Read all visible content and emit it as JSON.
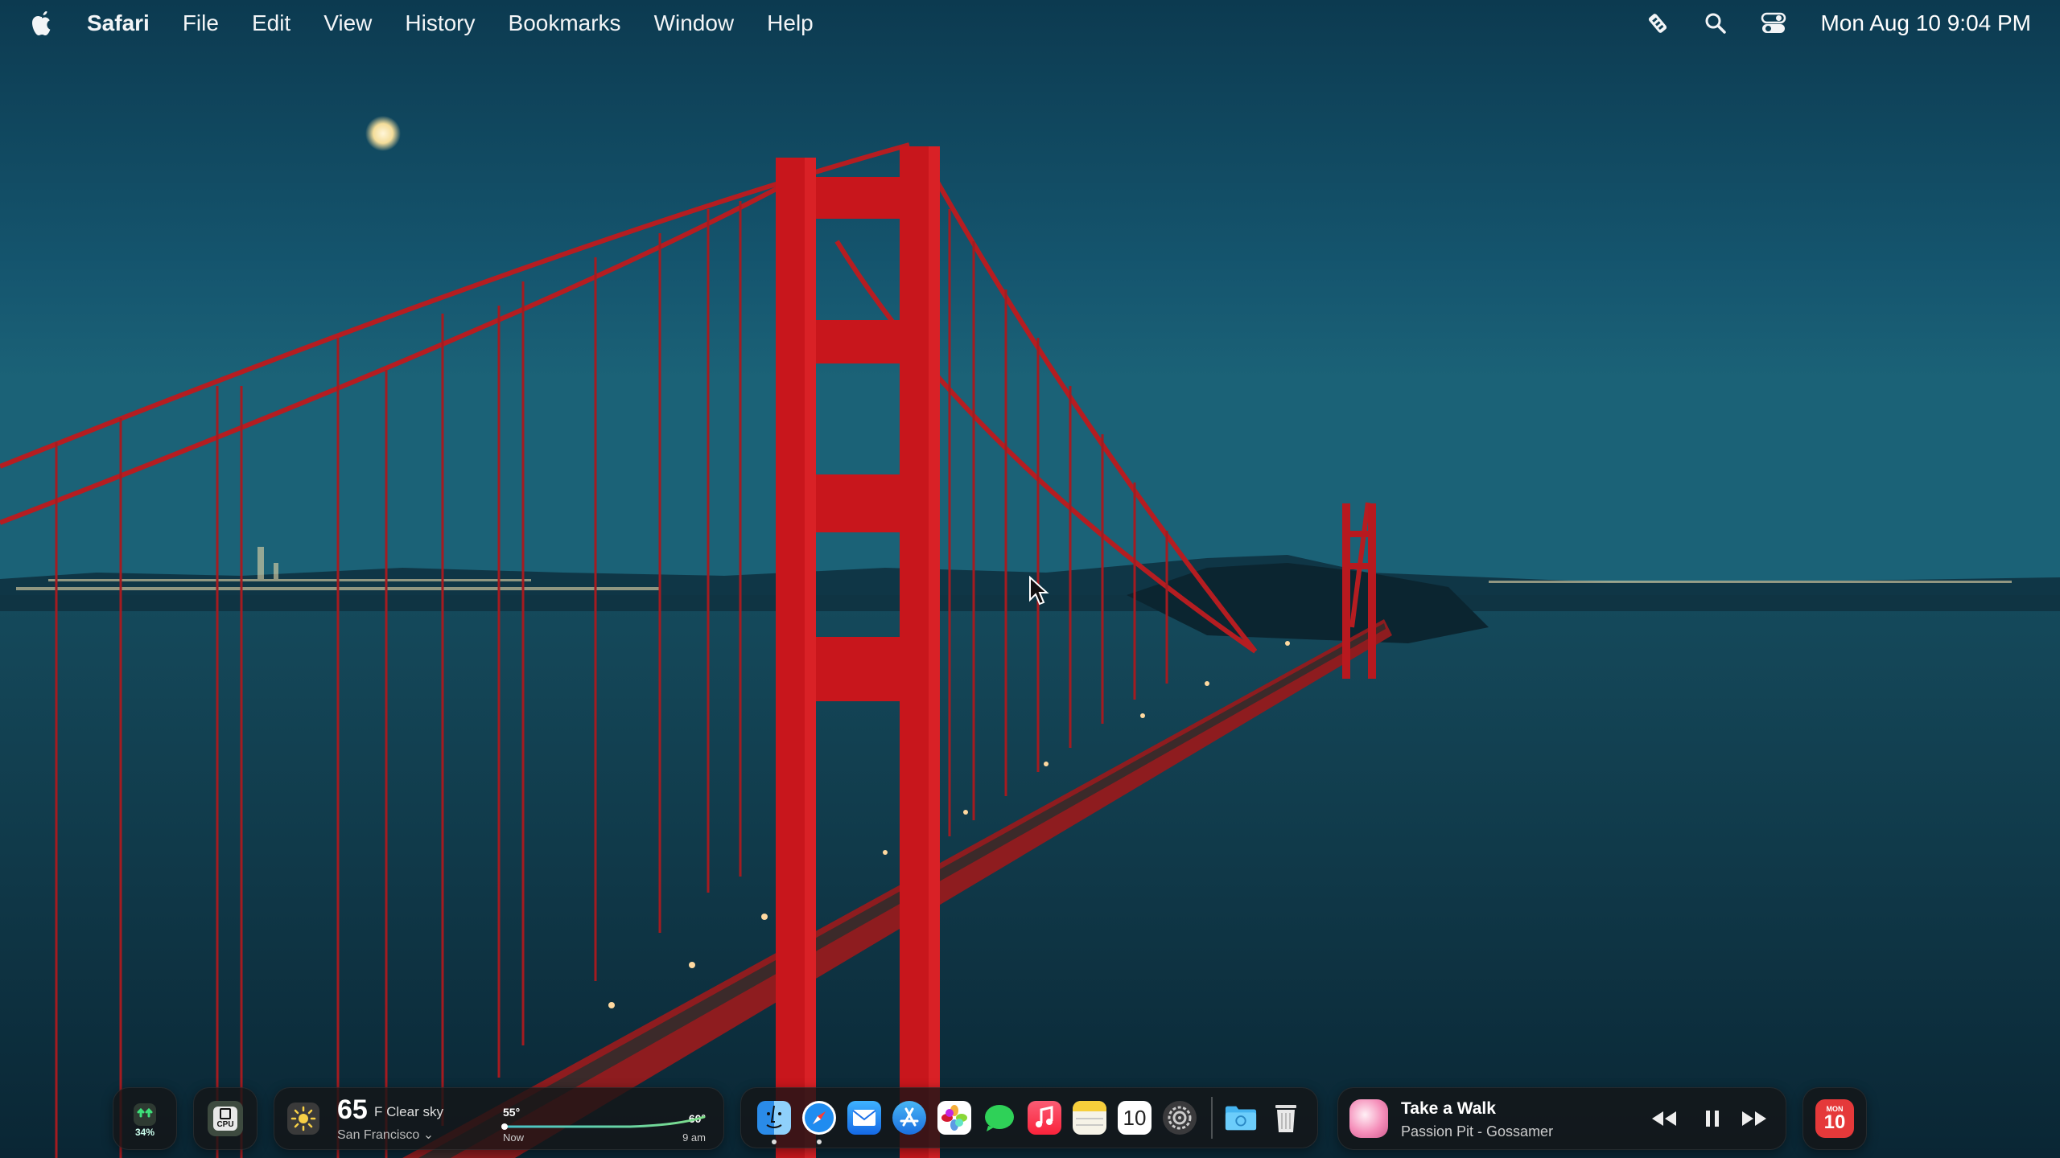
{
  "menubar": {
    "items": [
      "Safari",
      "File",
      "Edit",
      "View",
      "History",
      "Bookmarks",
      "Window",
      "Help"
    ],
    "status_icons": [
      "stopwatch-icon",
      "search-icon",
      "control-center-icon"
    ],
    "clock": "Mon Aug 10  9:04 PM"
  },
  "widgets": {
    "battery": {
      "value": "34%"
    },
    "cpu": {
      "label": "CPU"
    },
    "weather": {
      "temp": "65",
      "condition": "F Clear sky",
      "city": "San Francisco",
      "low": "55°",
      "high": "60°",
      "now_label": "Now",
      "later_label": "9 am"
    },
    "player": {
      "track": "Take a Walk",
      "artist": "Passion Pit - Gossamer"
    },
    "calendar": {
      "month": "MON",
      "day": "10"
    }
  },
  "dock": {
    "apps": [
      "finder",
      "safari",
      "mail",
      "app-store",
      "photos",
      "messages",
      "music",
      "notes",
      "calendar",
      "system-settings"
    ],
    "calendar_day": "10",
    "extras": [
      "downloads-folder",
      "trash"
    ]
  },
  "colors": {
    "accent": "#e8262b",
    "sky": "#12506a",
    "widget_bg": "#141416"
  }
}
